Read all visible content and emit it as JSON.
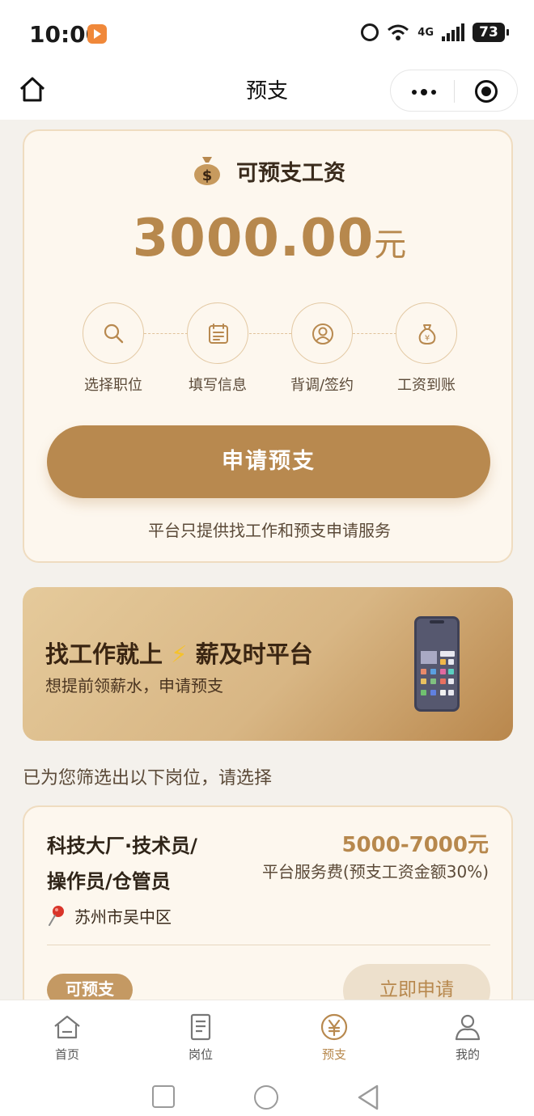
{
  "status_bar": {
    "time": "10:00",
    "network": "4G",
    "battery": "73"
  },
  "nav": {
    "title": "预支"
  },
  "advance_card": {
    "title": "可预支工资",
    "amount": "3000.00",
    "unit": "元",
    "steps": [
      {
        "label": "选择职位",
        "icon": "search-icon"
      },
      {
        "label": "填写信息",
        "icon": "form-icon"
      },
      {
        "label": "背调/签约",
        "icon": "user-icon"
      },
      {
        "label": "工资到账",
        "icon": "money-bag-icon"
      }
    ],
    "apply_label": "申请预支",
    "note": "平台只提供找工作和预支申请服务"
  },
  "banner": {
    "title_pre": "找工作就上",
    "bolt": "⚡",
    "title_post": "薪及时平台",
    "subtitle": "想提前领薪水，申请预支"
  },
  "filter_note": "已为您筛选出以下岗位，请选择",
  "job": {
    "title_line1": "科技大厂·技术员/",
    "title_line2": "操作员/仓管员",
    "salary": "5000-7000元",
    "fee": "平台服务费(预支工资金额30%)",
    "location": "苏州市吴中区",
    "tag": "可预支",
    "apply_label": "立即申请"
  },
  "tabs": [
    {
      "label": "首页",
      "icon": "home-icon"
    },
    {
      "label": "岗位",
      "icon": "document-icon"
    },
    {
      "label": "预支",
      "icon": "yen-icon",
      "active": true
    },
    {
      "label": "我的",
      "icon": "profile-icon"
    }
  ],
  "colors": {
    "accent": "#b8894f",
    "card_bg": "#fdf7ee",
    "card_border": "#efdcc0"
  }
}
